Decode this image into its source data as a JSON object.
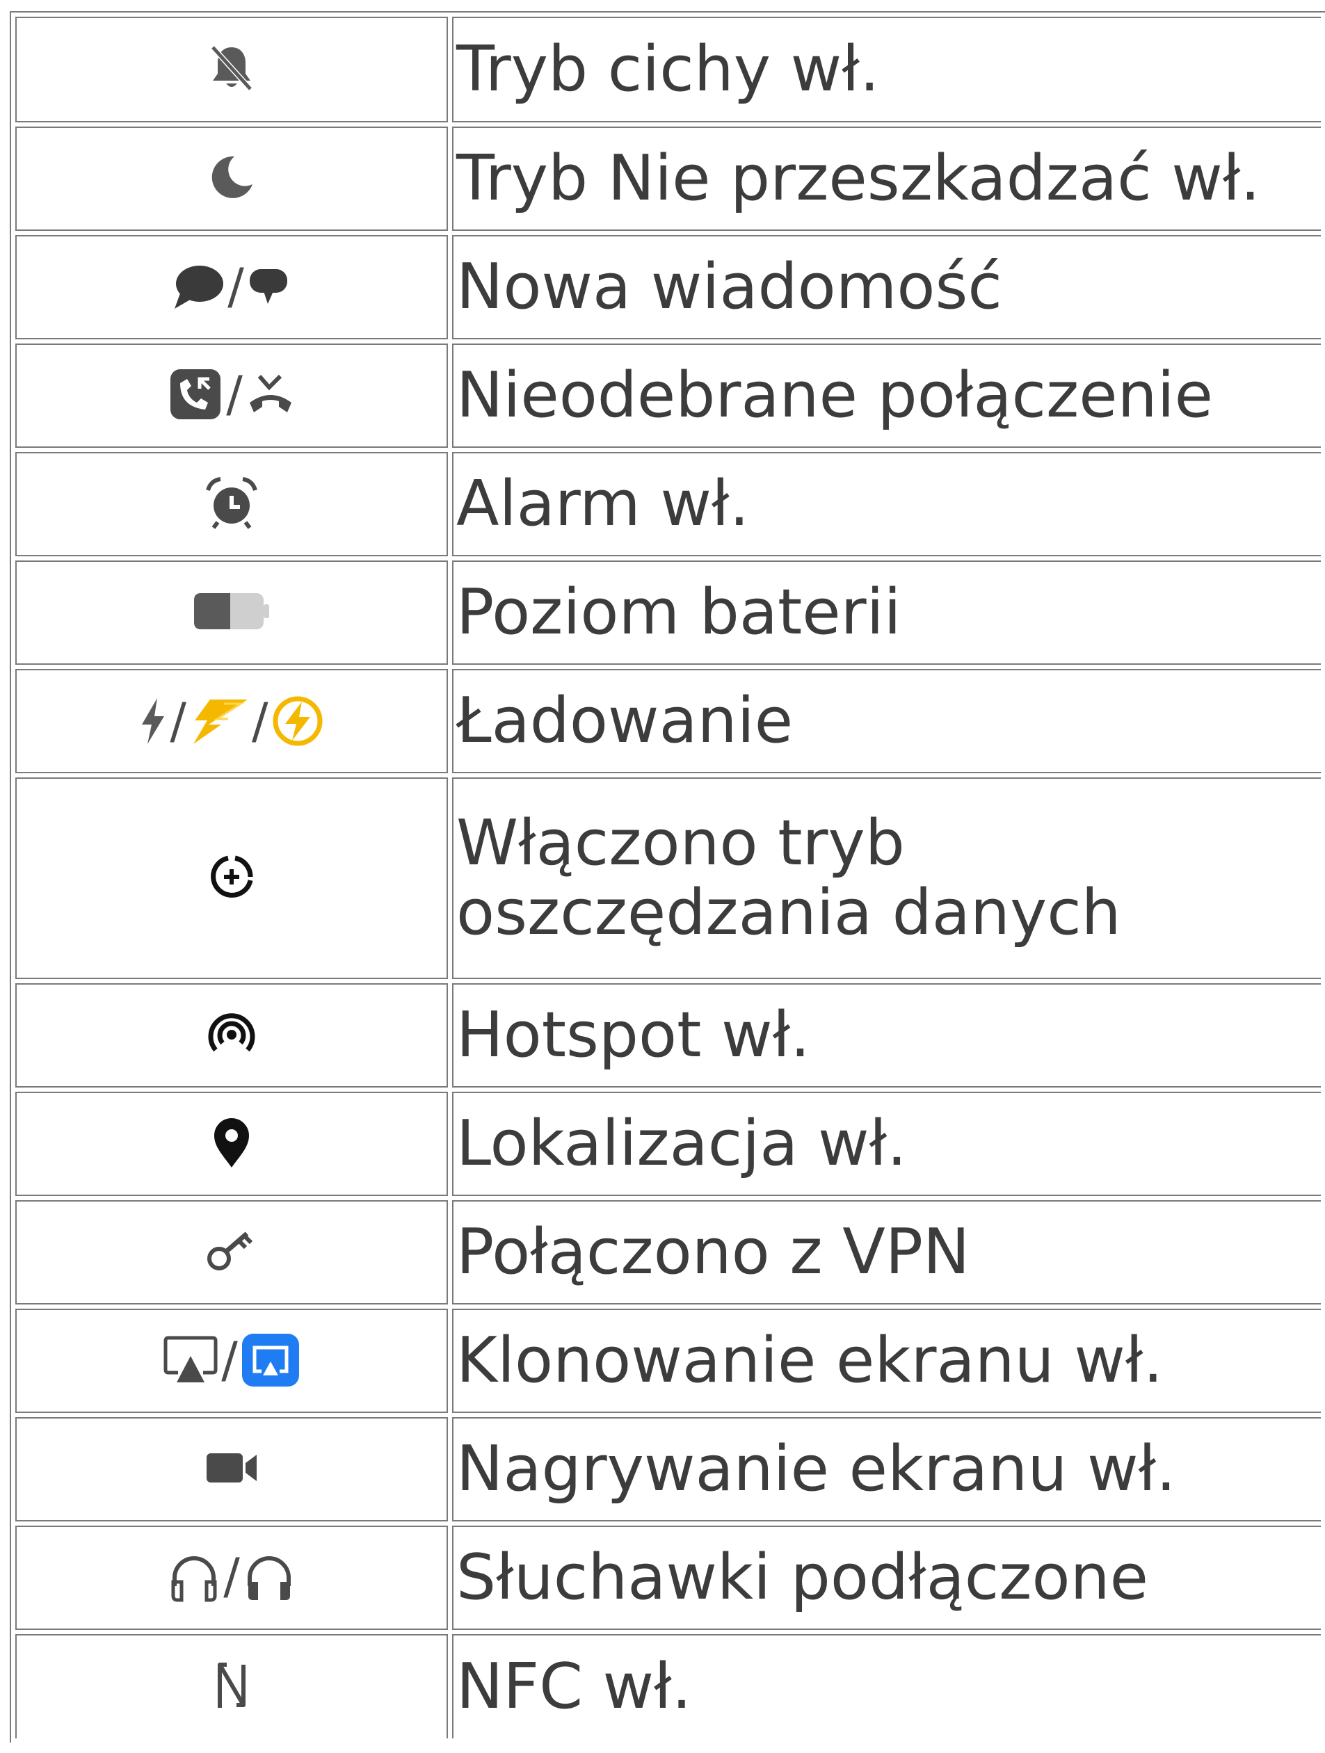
{
  "colors": {
    "text": "#3c3c3c",
    "border": "#7a7a7a",
    "icon_gray": "#5a5a5a",
    "icon_black": "#111111",
    "charging_yellow": "#f5b800",
    "screencast_blue": "#1f7cf2"
  },
  "rows": [
    {
      "icons": [
        "bell-off-icon"
      ],
      "label": "Tryb cichy wł."
    },
    {
      "icons": [
        "moon-icon"
      ],
      "label": "Tryb Nie przeszkadzać wł."
    },
    {
      "icons": [
        "message-bubble-icon",
        "message-bubble-alt-icon"
      ],
      "label": "Nowa wiadomość"
    },
    {
      "icons": [
        "missed-call-icon",
        "missed-call-alt-icon"
      ],
      "label": "Nieodebrane połączenie"
    },
    {
      "icons": [
        "alarm-clock-icon"
      ],
      "label": "Alarm wł."
    },
    {
      "icons": [
        "battery-icon"
      ],
      "label": "Poziom baterii"
    },
    {
      "icons": [
        "lightning-icon",
        "lightning-fast-icon",
        "lightning-circle-icon"
      ],
      "label": "Ładowanie"
    },
    {
      "icons": [
        "data-saver-icon"
      ],
      "label": "Włączono tryb oszczędzania danych"
    },
    {
      "icons": [
        "hotspot-icon"
      ],
      "label": "Hotspot wł."
    },
    {
      "icons": [
        "location-pin-icon"
      ],
      "label": "Lokalizacja wł."
    },
    {
      "icons": [
        "vpn-key-icon"
      ],
      "label": "Połączono z VPN"
    },
    {
      "icons": [
        "screencast-icon",
        "screencast-active-icon"
      ],
      "label": "Klonowanie ekranu wł."
    },
    {
      "icons": [
        "video-camera-icon"
      ],
      "label": "Nagrywanie ekranu wł."
    },
    {
      "icons": [
        "headphones-icon",
        "headphones-alt-icon"
      ],
      "label": "Słuchawki podłączone"
    },
    {
      "icons": [
        "nfc-icon"
      ],
      "label": "NFC wł."
    }
  ],
  "separator": "/"
}
